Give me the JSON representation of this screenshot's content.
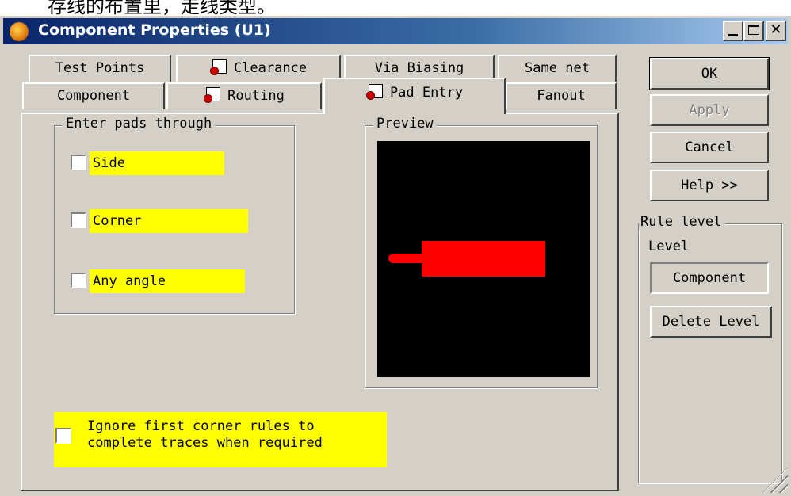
{
  "top_text": "存线的布置里，走线类型。",
  "window": {
    "title": "Component Properties (U1)"
  },
  "titlebar_buttons": [
    "minimize-button",
    "maximize-button",
    "close-button"
  ],
  "tabs_back": [
    "Test Points",
    "Clearance",
    "Via Biasing",
    "Same net"
  ],
  "tabs_front": [
    "Component",
    "Routing",
    "Pad Entry",
    "Fanout"
  ],
  "active_tab": "Pad Entry",
  "pad_group": {
    "legend": "Enter pads through",
    "options": [
      {
        "label": "Side",
        "checked": false
      },
      {
        "label": "Corner",
        "checked": false
      },
      {
        "label": "Any angle",
        "checked": false
      }
    ]
  },
  "preview": {
    "legend": "Preview",
    "pad_color": "#ff0000",
    "background": "#000000"
  },
  "ignore_option": {
    "line1": "Ignore first corner rules to",
    "line2": "complete traces when required",
    "checked": false
  },
  "buttons": {
    "ok": "OK",
    "apply": "Apply",
    "cancel": "Cancel",
    "help": "Help >>"
  },
  "rule_level": {
    "legend": "Rule level",
    "level_label": "Level",
    "level_value": "Component",
    "delete_button": "Delete Level"
  },
  "colors": {
    "highlight": "#ffff00",
    "titlebar_start": "#0a246a",
    "face": "#d4d0c8"
  }
}
